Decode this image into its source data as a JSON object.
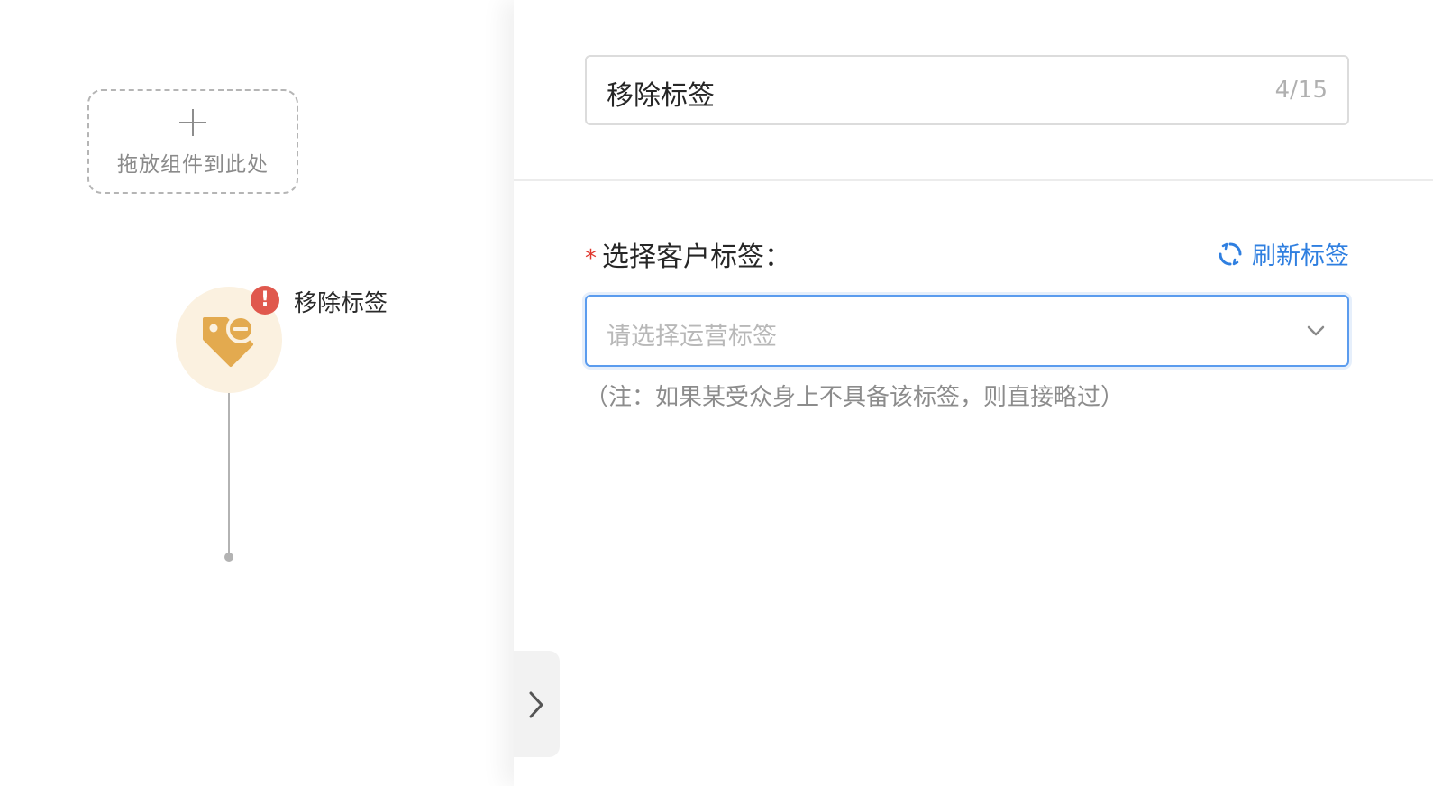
{
  "canvas": {
    "drop_zone": {
      "label": "拖放组件到此处",
      "icon": "plus-icon"
    },
    "node": {
      "title": "移除标签",
      "icon": "tag-remove-icon",
      "status_icon": "error-icon",
      "status_text": "!",
      "colors": {
        "icon": "#e3aa4f",
        "circle_bg": "#fbf1e0",
        "error": "#e0584d"
      }
    }
  },
  "panel": {
    "name_input": {
      "value": "移除标签",
      "counter": "4/15"
    },
    "tag_field": {
      "required_mark": "*",
      "label": "选择客户标签：",
      "refresh_label": "刷新标签",
      "refresh_icon": "refresh-icon",
      "select_placeholder": "请选择运营标签",
      "dropdown_icon": "chevron-down-icon",
      "hint": "（注：如果某受众身上不具备该标签，则直接略过）"
    },
    "colors": {
      "accent": "#2f7fe0",
      "required": "#e0382e",
      "focus_border": "#5b9cee"
    }
  },
  "collapse_handle": {
    "icon": "chevron-right-icon"
  }
}
